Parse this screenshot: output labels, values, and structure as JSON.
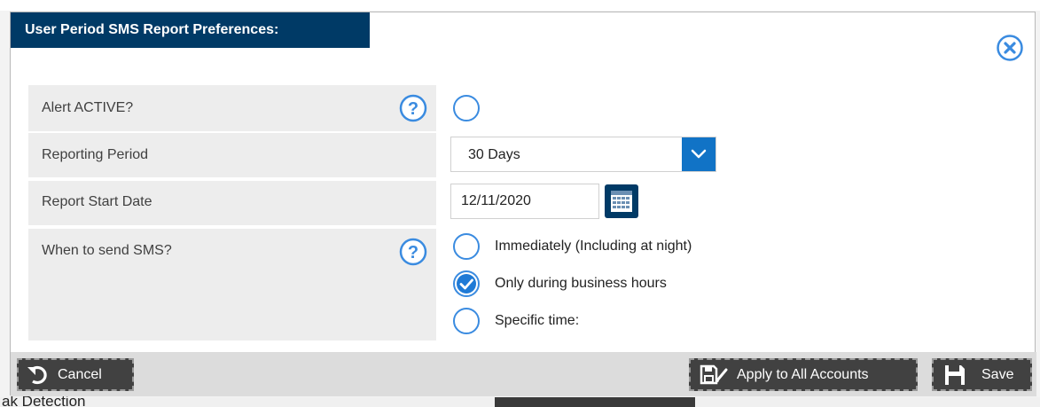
{
  "dialog": {
    "title": "User Period SMS Report Preferences:"
  },
  "form": {
    "alert_active": {
      "label": "Alert ACTIVE?",
      "checked": false
    },
    "reporting_period": {
      "label": "Reporting Period",
      "value": "30 Days"
    },
    "report_start_date": {
      "label": "Report Start Date",
      "value": "12/11/2020"
    },
    "when_to_send": {
      "label": "When to send SMS?",
      "options": [
        {
          "label": "Immediately (Including at night)",
          "checked": false
        },
        {
          "label": "Only during business hours",
          "checked": true
        },
        {
          "label": "Specific time:",
          "checked": false
        }
      ]
    }
  },
  "footer": {
    "cancel_label": "Cancel",
    "apply_all_label": "Apply to All Accounts",
    "save_label": "Save"
  },
  "background": {
    "bottom_text": "ak Detection"
  },
  "colors": {
    "title_bg": "#003a66",
    "accent": "#1173c6",
    "label_bg": "#ededed",
    "footer_bg": "#dcdcdc",
    "button_bg": "#414141"
  }
}
